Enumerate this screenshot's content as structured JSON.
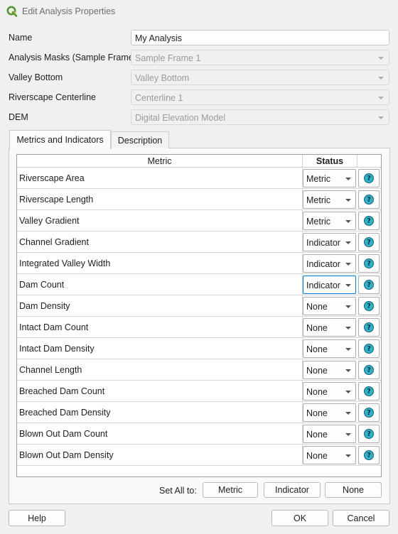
{
  "window": {
    "title": "Edit Analysis Properties"
  },
  "form": {
    "name": {
      "label": "Name",
      "value": "My Analysis"
    },
    "masks": {
      "label": "Analysis Masks (Sample Frame)",
      "value": "Sample Frame 1"
    },
    "valley": {
      "label": "Valley Bottom",
      "value": "Valley Bottom"
    },
    "centerline": {
      "label": "Riverscape Centerline",
      "value": "Centerline 1"
    },
    "dem": {
      "label": "DEM",
      "value": "Digital Elevation Model"
    }
  },
  "tabs": {
    "metrics": "Metrics and Indicators",
    "description": "Description"
  },
  "table": {
    "col_metric": "Metric",
    "col_status": "Status",
    "help_glyph": "?",
    "rows": [
      {
        "metric": "Riverscape Area",
        "status": "Metric"
      },
      {
        "metric": "Riverscape Length",
        "status": "Metric"
      },
      {
        "metric": "Valley Gradient",
        "status": "Metric"
      },
      {
        "metric": "Channel Gradient",
        "status": "Indicator"
      },
      {
        "metric": "Integrated Valley Width",
        "status": "Indicator"
      },
      {
        "metric": "Dam Count",
        "status": "Indicator"
      },
      {
        "metric": "Dam Density",
        "status": "None"
      },
      {
        "metric": "Intact Dam Count",
        "status": "None"
      },
      {
        "metric": "Intact Dam Density",
        "status": "None"
      },
      {
        "metric": "Channel Length",
        "status": "None"
      },
      {
        "metric": "Breached Dam Count",
        "status": "None"
      },
      {
        "metric": "Breached Dam Density",
        "status": "None"
      },
      {
        "metric": "Blown Out Dam Count",
        "status": "None"
      },
      {
        "metric": "Blown Out Dam Density",
        "status": "None"
      }
    ]
  },
  "set_all": {
    "label": "Set All to:",
    "metric": "Metric",
    "indicator": "Indicator",
    "none": "None"
  },
  "buttons": {
    "help": "Help",
    "ok": "OK",
    "cancel": "Cancel"
  },
  "colors": {
    "accent": "#0078d4",
    "help_icon": "#2fb3c9",
    "qgis_green": "#589632"
  }
}
